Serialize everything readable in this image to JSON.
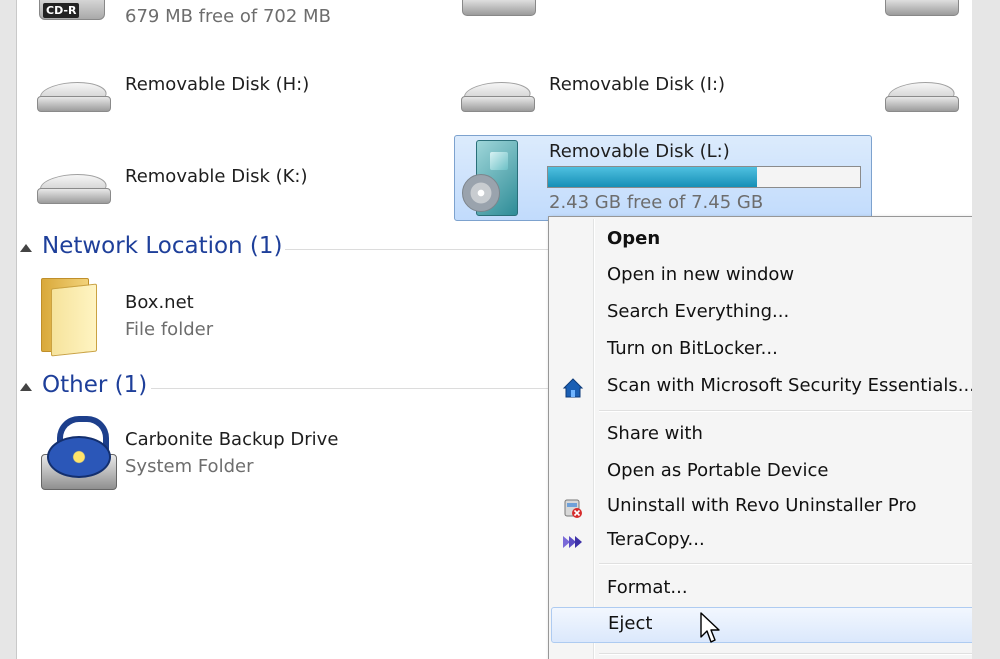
{
  "drives_top": {
    "cdr": {
      "badge": "CD-R",
      "free_text": "679 MB free of 702 MB"
    }
  },
  "drives": {
    "h": {
      "label": "Removable Disk (H:)"
    },
    "i": {
      "label": "Removable Disk (I:)"
    },
    "k": {
      "label": "Removable Disk (K:)"
    },
    "l": {
      "label": "Removable Disk (L:)",
      "free_text": "2.43 GB free of 7.45 GB",
      "used_fraction": 0.67
    }
  },
  "sections": {
    "network": {
      "title": "Network Location (1)"
    },
    "other": {
      "title": "Other (1)"
    }
  },
  "network_items": {
    "boxnet": {
      "name": "Box.net",
      "type": "File folder"
    }
  },
  "other_items": {
    "carbonite": {
      "name": "Carbonite Backup Drive",
      "type": "System Folder"
    }
  },
  "context_menu": {
    "items": [
      {
        "label": "Open",
        "bold": true
      },
      {
        "label": "Open in new window"
      },
      {
        "label": "Search Everything..."
      },
      {
        "label": "Turn on BitLocker..."
      },
      {
        "label": "Scan with Microsoft Security Essentials...",
        "icon": "mse-icon"
      },
      {
        "label": "Share with"
      },
      {
        "label": "Open as Portable Device"
      },
      {
        "label": "Uninstall with Revo Uninstaller Pro",
        "icon": "revo-icon"
      },
      {
        "label": "TeraCopy...",
        "icon": "teracopy-icon"
      },
      {
        "label": "Format..."
      },
      {
        "label": "Eject",
        "hovered": true
      }
    ]
  },
  "colors": {
    "accent": "#1e3f9a",
    "selection": "#c1dbfc",
    "progress": "#168fb6"
  }
}
